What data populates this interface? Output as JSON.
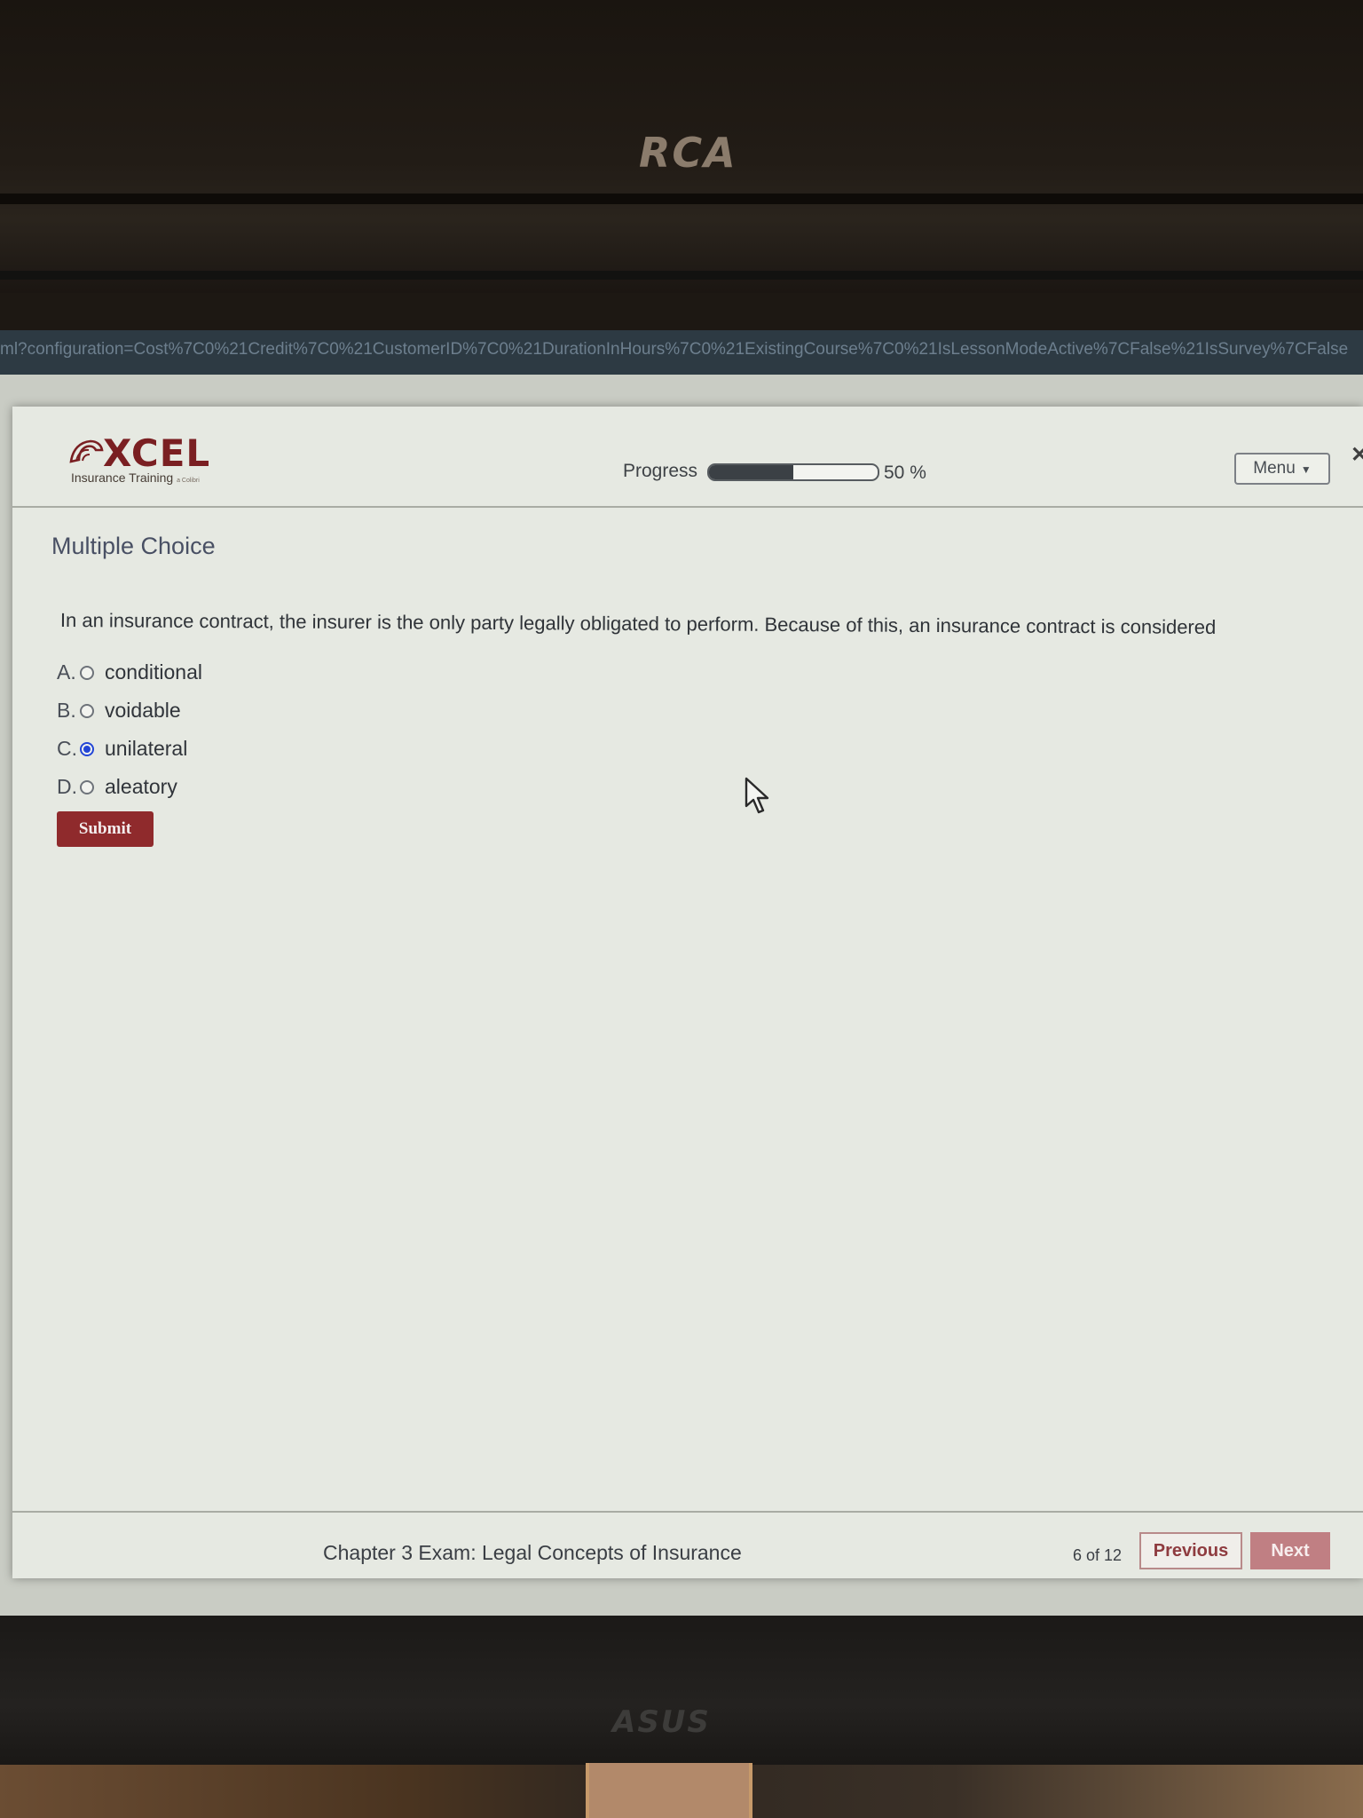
{
  "monitor": {
    "brand_top": "RCA",
    "brand_bottom": "ASUS"
  },
  "browser": {
    "url_fragment": "ml?configuration=Cost%7C0%21Credit%7C0%21CustomerID%7C0%21DurationInHours%7C0%21ExistingCourse%7C0%21IsLessonModeActive%7CFalse%21IsSurvey%7CFalse"
  },
  "header": {
    "logo_text": "XCEL",
    "logo_subtitle": "Insurance Training",
    "logo_tag": "a Colibri",
    "progress_label": "Progress",
    "progress_fraction": 0.5,
    "progress_value_text": "50 %",
    "menu_label": "Menu"
  },
  "question": {
    "section_title": "Multiple Choice",
    "text": "In an insurance contract, the insurer is the only party legally obligated to perform. Because of this, an insurance contract is considered",
    "options": [
      {
        "letter": "A.",
        "label": "conditional",
        "selected": false
      },
      {
        "letter": "B.",
        "label": "voidable",
        "selected": false
      },
      {
        "letter": "C.",
        "label": "unilateral",
        "selected": true
      },
      {
        "letter": "D.",
        "label": "aleatory",
        "selected": false
      }
    ],
    "submit_label": "Submit"
  },
  "footer": {
    "course_title": "Chapter 3 Exam: Legal Concepts of Insurance",
    "page_count": "6 of 12",
    "previous_label": "Previous",
    "next_label": "Next"
  },
  "colors": {
    "accent_red": "#8f2a2c",
    "radio_selected": "#2346d6",
    "next_button": "#c07f83"
  }
}
